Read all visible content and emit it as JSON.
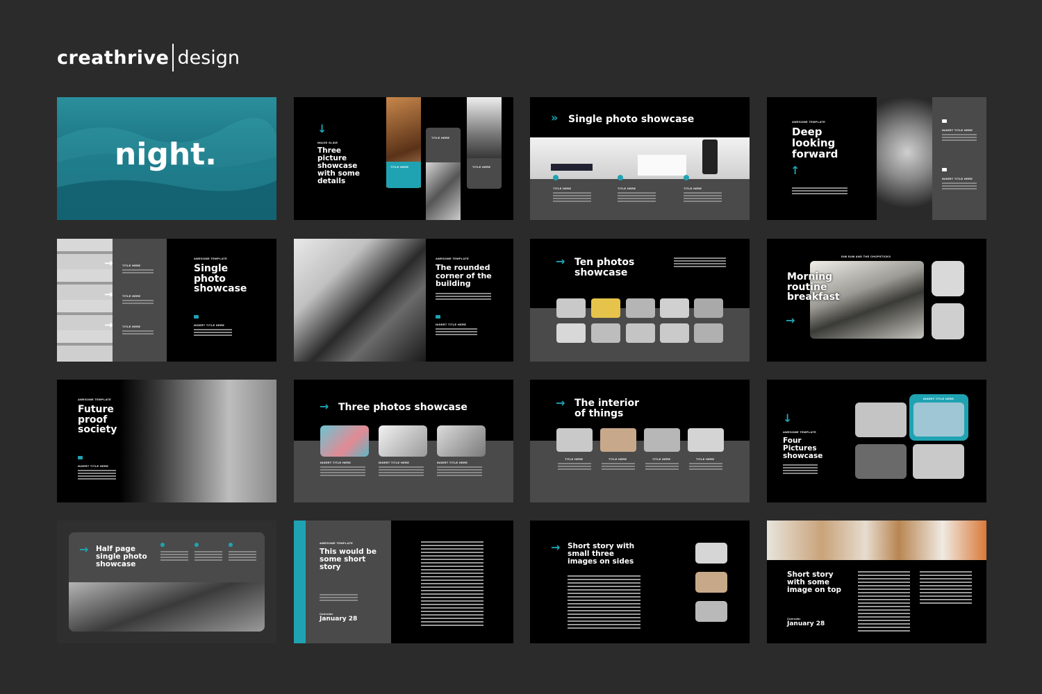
{
  "logo": {
    "brand": "creathrive",
    "suffix": "design"
  },
  "colors": {
    "accent": "#1fa3b3",
    "background": "#2b2b2b",
    "slide": "#000000",
    "panel": "#4a4a4a"
  },
  "slides": {
    "s1": {
      "title": "night."
    },
    "s2": {
      "kicker": "IMAGE SLIDE",
      "title": "Three\npicture\nshowcase\nwith some\ndetails",
      "label1": "TITLE HERE",
      "label2": "TITLE HERE",
      "label3": "TITLE HERE",
      "icon": "arrow-down-icon"
    },
    "s3": {
      "title": "Single photo showcase",
      "items": [
        "TITLE HERE",
        "TITLE HERE",
        "TITLE HERE"
      ],
      "icon": "double-chevron-icon"
    },
    "s4": {
      "kicker": "AWESOME TEMPLATE",
      "title": "Deep\nlooking\nforward",
      "label1": "INSERT TITLE HERE",
      "label2": "INSERT TITLE HERE",
      "icon": "arrow-up-icon"
    },
    "s5": {
      "kicker": "AWESOME TEMPLATE",
      "title": "Single\nphoto\nshowcase",
      "items": [
        "TITLE HERE",
        "TITLE HERE",
        "TITLE HERE"
      ],
      "label": "INSERT TITLE HERE"
    },
    "s6": {
      "kicker": "AWESOME TEMPLATE",
      "title": "The rounded\ncorner of the\nbuilding",
      "label": "INSERT TITLE HERE"
    },
    "s7": {
      "title": "Ten photos\nshowcase"
    },
    "s8": {
      "kicker": "DIM SUM AND THE CHOPSTICKS",
      "title": "Morning\nroutine\nbreakfast"
    },
    "s9": {
      "kicker": "AWESOME TEMPLATE",
      "title": "Future\nproof\nsociety",
      "label": "INSERT TITLE HERE"
    },
    "s10": {
      "title": "Three photos showcase",
      "items": [
        "INSERT TITLE HERE",
        "INSERT TITLE HERE",
        "INSERT TITLE HERE"
      ]
    },
    "s11": {
      "title": "The interior\nof things",
      "items": [
        "TITLE HERE",
        "TITLE HERE",
        "TITLE HERE",
        "TITLE HERE"
      ]
    },
    "s12": {
      "kicker": "AWESOME TEMPLATE",
      "title": "Four\nPictures\nshowcase",
      "badge": "INSERT TITLE HERE"
    },
    "s13": {
      "title": "Half page\nsingle photo\nshowcase"
    },
    "s14": {
      "kicker": "AWESOME TEMPLATE",
      "title": "This would be\nsome short\nstory",
      "date_label": "Calendar",
      "date": "January 28"
    },
    "s15": {
      "title": "Short story with\nsmall three\nimages on sides"
    },
    "s16": {
      "title": "Short story\nwith some\nimage on top",
      "date_label": "Calendar",
      "date": "January 28"
    }
  }
}
